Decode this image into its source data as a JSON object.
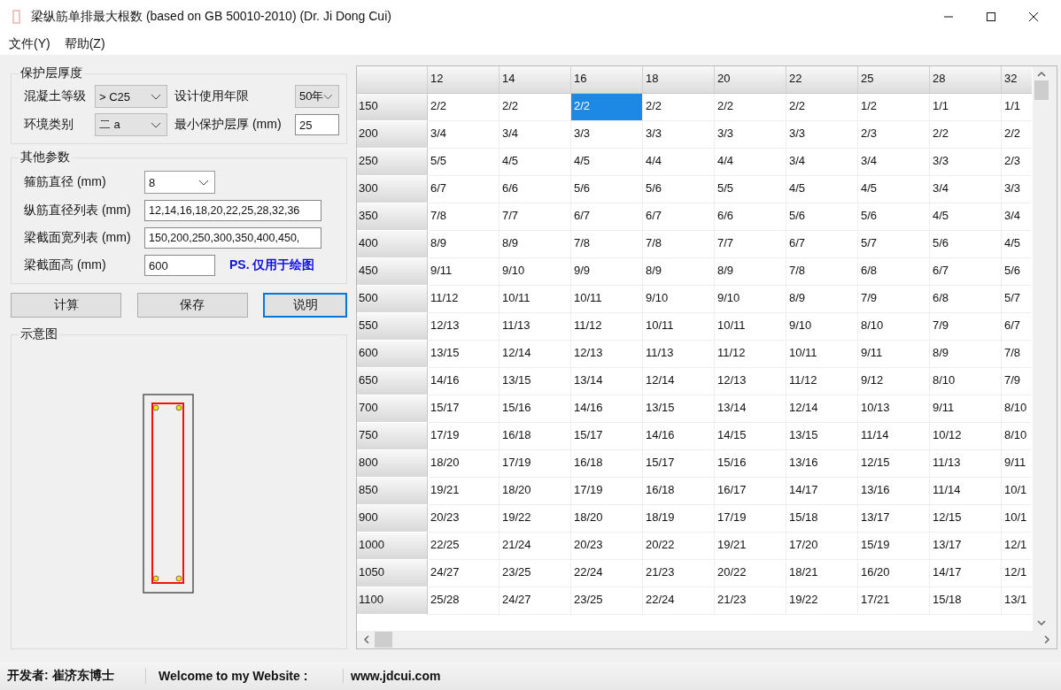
{
  "window": {
    "title": "梁纵筋单排最大根数 (based on GB 50010-2010) (Dr. Ji Dong Cui)"
  },
  "menu": [
    {
      "label": "文件(Y)"
    },
    {
      "label": "帮助(Z)"
    }
  ],
  "cover_group": {
    "title": "保护层厚度",
    "fields": [
      {
        "label": "混凝土等级",
        "kind": "select",
        "value": "> C25"
      },
      {
        "label": "设计使用年限",
        "kind": "select",
        "value": "50年"
      },
      {
        "label": "环境类别",
        "kind": "select",
        "value": "二 a"
      },
      {
        "label": "最小保护层厚 (mm)",
        "kind": "input",
        "value": "25"
      }
    ]
  },
  "other_group": {
    "title": "其他参数",
    "fields": [
      {
        "label": "箍筋直径 (mm)",
        "kind": "select",
        "value": "8"
      },
      {
        "label": "纵筋直径列表 (mm)",
        "kind": "input",
        "value": "12,14,16,18,20,22,25,28,32,36"
      },
      {
        "label": "梁截面宽列表 (mm)",
        "kind": "input",
        "value": "150,200,250,300,350,400,450,"
      },
      {
        "label": "梁截面高 (mm)",
        "kind": "short",
        "value": "600",
        "note": "PS. 仅用于绘图"
      }
    ]
  },
  "buttons": [
    {
      "label": "计算",
      "focused": false
    },
    {
      "label": "保存",
      "focused": false
    },
    {
      "label": "说明",
      "focused": true
    }
  ],
  "diagram": {
    "title": "示意图"
  },
  "table": {
    "columns": [
      "12",
      "14",
      "16",
      "18",
      "20",
      "22",
      "25",
      "28",
      "32"
    ],
    "rows": [
      {
        "header": "150",
        "cells": [
          {
            "text": "2/2",
            "selected": false
          },
          {
            "text": "2/2",
            "selected": false
          },
          {
            "text": "2/2",
            "selected": true
          },
          {
            "text": "2/2",
            "selected": false
          },
          {
            "text": "2/2",
            "selected": false
          },
          {
            "text": "2/2",
            "selected": false
          },
          {
            "text": "1/2",
            "selected": false
          },
          {
            "text": "1/1",
            "selected": false
          },
          {
            "text": "1/1",
            "selected": false
          }
        ]
      },
      {
        "header": "200",
        "cells": [
          {
            "text": "3/4",
            "selected": false
          },
          {
            "text": "3/4",
            "selected": false
          },
          {
            "text": "3/3",
            "selected": false
          },
          {
            "text": "3/3",
            "selected": false
          },
          {
            "text": "3/3",
            "selected": false
          },
          {
            "text": "3/3",
            "selected": false
          },
          {
            "text": "2/3",
            "selected": false
          },
          {
            "text": "2/2",
            "selected": false
          },
          {
            "text": "2/2",
            "selected": false
          }
        ]
      },
      {
        "header": "250",
        "cells": [
          {
            "text": "5/5",
            "selected": false
          },
          {
            "text": "4/5",
            "selected": false
          },
          {
            "text": "4/5",
            "selected": false
          },
          {
            "text": "4/4",
            "selected": false
          },
          {
            "text": "4/4",
            "selected": false
          },
          {
            "text": "3/4",
            "selected": false
          },
          {
            "text": "3/4",
            "selected": false
          },
          {
            "text": "3/3",
            "selected": false
          },
          {
            "text": "2/3",
            "selected": false
          }
        ]
      },
      {
        "header": "300",
        "cells": [
          {
            "text": "6/7",
            "selected": false
          },
          {
            "text": "6/6",
            "selected": false
          },
          {
            "text": "5/6",
            "selected": false
          },
          {
            "text": "5/6",
            "selected": false
          },
          {
            "text": "5/5",
            "selected": false
          },
          {
            "text": "4/5",
            "selected": false
          },
          {
            "text": "4/5",
            "selected": false
          },
          {
            "text": "3/4",
            "selected": false
          },
          {
            "text": "3/3",
            "selected": false
          }
        ]
      },
      {
        "header": "350",
        "cells": [
          {
            "text": "7/8",
            "selected": false
          },
          {
            "text": "7/7",
            "selected": false
          },
          {
            "text": "6/7",
            "selected": false
          },
          {
            "text": "6/7",
            "selected": false
          },
          {
            "text": "6/6",
            "selected": false
          },
          {
            "text": "5/6",
            "selected": false
          },
          {
            "text": "5/6",
            "selected": false
          },
          {
            "text": "4/5",
            "selected": false
          },
          {
            "text": "3/4",
            "selected": false
          }
        ]
      },
      {
        "header": "400",
        "cells": [
          {
            "text": "8/9",
            "selected": false
          },
          {
            "text": "8/9",
            "selected": false
          },
          {
            "text": "7/8",
            "selected": false
          },
          {
            "text": "7/8",
            "selected": false
          },
          {
            "text": "7/7",
            "selected": false
          },
          {
            "text": "6/7",
            "selected": false
          },
          {
            "text": "5/7",
            "selected": false
          },
          {
            "text": "5/6",
            "selected": false
          },
          {
            "text": "4/5",
            "selected": false
          }
        ]
      },
      {
        "header": "450",
        "cells": [
          {
            "text": "9/11",
            "selected": false
          },
          {
            "text": "9/10",
            "selected": false
          },
          {
            "text": "9/9",
            "selected": false
          },
          {
            "text": "8/9",
            "selected": false
          },
          {
            "text": "8/9",
            "selected": false
          },
          {
            "text": "7/8",
            "selected": false
          },
          {
            "text": "6/8",
            "selected": false
          },
          {
            "text": "6/7",
            "selected": false
          },
          {
            "text": "5/6",
            "selected": false
          }
        ]
      },
      {
        "header": "500",
        "cells": [
          {
            "text": "11/12",
            "selected": false
          },
          {
            "text": "10/11",
            "selected": false
          },
          {
            "text": "10/11",
            "selected": false
          },
          {
            "text": "9/10",
            "selected": false
          },
          {
            "text": "9/10",
            "selected": false
          },
          {
            "text": "8/9",
            "selected": false
          },
          {
            "text": "7/9",
            "selected": false
          },
          {
            "text": "6/8",
            "selected": false
          },
          {
            "text": "5/7",
            "selected": false
          }
        ]
      },
      {
        "header": "550",
        "cells": [
          {
            "text": "12/13",
            "selected": false
          },
          {
            "text": "11/13",
            "selected": false
          },
          {
            "text": "11/12",
            "selected": false
          },
          {
            "text": "10/11",
            "selected": false
          },
          {
            "text": "10/11",
            "selected": false
          },
          {
            "text": "9/10",
            "selected": false
          },
          {
            "text": "8/10",
            "selected": false
          },
          {
            "text": "7/9",
            "selected": false
          },
          {
            "text": "6/7",
            "selected": false
          }
        ]
      },
      {
        "header": "600",
        "cells": [
          {
            "text": "13/15",
            "selected": false
          },
          {
            "text": "12/14",
            "selected": false
          },
          {
            "text": "12/13",
            "selected": false
          },
          {
            "text": "11/13",
            "selected": false
          },
          {
            "text": "11/12",
            "selected": false
          },
          {
            "text": "10/11",
            "selected": false
          },
          {
            "text": "9/11",
            "selected": false
          },
          {
            "text": "8/9",
            "selected": false
          },
          {
            "text": "7/8",
            "selected": false
          }
        ]
      },
      {
        "header": "650",
        "cells": [
          {
            "text": "14/16",
            "selected": false
          },
          {
            "text": "13/15",
            "selected": false
          },
          {
            "text": "13/14",
            "selected": false
          },
          {
            "text": "12/14",
            "selected": false
          },
          {
            "text": "12/13",
            "selected": false
          },
          {
            "text": "11/12",
            "selected": false
          },
          {
            "text": "9/12",
            "selected": false
          },
          {
            "text": "8/10",
            "selected": false
          },
          {
            "text": "7/9",
            "selected": false
          }
        ]
      },
      {
        "header": "700",
        "cells": [
          {
            "text": "15/17",
            "selected": false
          },
          {
            "text": "15/16",
            "selected": false
          },
          {
            "text": "14/16",
            "selected": false
          },
          {
            "text": "13/15",
            "selected": false
          },
          {
            "text": "13/14",
            "selected": false
          },
          {
            "text": "12/14",
            "selected": false
          },
          {
            "text": "10/13",
            "selected": false
          },
          {
            "text": "9/11",
            "selected": false
          },
          {
            "text": "8/10",
            "selected": false
          }
        ]
      },
      {
        "header": "750",
        "cells": [
          {
            "text": "17/19",
            "selected": false
          },
          {
            "text": "16/18",
            "selected": false
          },
          {
            "text": "15/17",
            "selected": false
          },
          {
            "text": "14/16",
            "selected": false
          },
          {
            "text": "14/15",
            "selected": false
          },
          {
            "text": "13/15",
            "selected": false
          },
          {
            "text": "11/14",
            "selected": false
          },
          {
            "text": "10/12",
            "selected": false
          },
          {
            "text": "8/10",
            "selected": false
          }
        ]
      },
      {
        "header": "800",
        "cells": [
          {
            "text": "18/20",
            "selected": false
          },
          {
            "text": "17/19",
            "selected": false
          },
          {
            "text": "16/18",
            "selected": false
          },
          {
            "text": "15/17",
            "selected": false
          },
          {
            "text": "15/16",
            "selected": false
          },
          {
            "text": "13/16",
            "selected": false
          },
          {
            "text": "12/15",
            "selected": false
          },
          {
            "text": "11/13",
            "selected": false
          },
          {
            "text": "9/11",
            "selected": false
          }
        ]
      },
      {
        "header": "850",
        "cells": [
          {
            "text": "19/21",
            "selected": false
          },
          {
            "text": "18/20",
            "selected": false
          },
          {
            "text": "17/19",
            "selected": false
          },
          {
            "text": "16/18",
            "selected": false
          },
          {
            "text": "16/17",
            "selected": false
          },
          {
            "text": "14/17",
            "selected": false
          },
          {
            "text": "13/16",
            "selected": false
          },
          {
            "text": "11/14",
            "selected": false
          },
          {
            "text": "10/1",
            "selected": false
          }
        ]
      },
      {
        "header": "900",
        "cells": [
          {
            "text": "20/23",
            "selected": false
          },
          {
            "text": "19/22",
            "selected": false
          },
          {
            "text": "18/20",
            "selected": false
          },
          {
            "text": "18/19",
            "selected": false
          },
          {
            "text": "17/19",
            "selected": false
          },
          {
            "text": "15/18",
            "selected": false
          },
          {
            "text": "13/17",
            "selected": false
          },
          {
            "text": "12/15",
            "selected": false
          },
          {
            "text": "10/1",
            "selected": false
          }
        ]
      },
      {
        "header": "1000",
        "cells": [
          {
            "text": "22/25",
            "selected": false
          },
          {
            "text": "21/24",
            "selected": false
          },
          {
            "text": "20/23",
            "selected": false
          },
          {
            "text": "20/22",
            "selected": false
          },
          {
            "text": "19/21",
            "selected": false
          },
          {
            "text": "17/20",
            "selected": false
          },
          {
            "text": "15/19",
            "selected": false
          },
          {
            "text": "13/17",
            "selected": false
          },
          {
            "text": "12/1",
            "selected": false
          }
        ]
      },
      {
        "header": "1050",
        "cells": [
          {
            "text": "24/27",
            "selected": false
          },
          {
            "text": "23/25",
            "selected": false
          },
          {
            "text": "22/24",
            "selected": false
          },
          {
            "text": "21/23",
            "selected": false
          },
          {
            "text": "20/22",
            "selected": false
          },
          {
            "text": "18/21",
            "selected": false
          },
          {
            "text": "16/20",
            "selected": false
          },
          {
            "text": "14/17",
            "selected": false
          },
          {
            "text": "12/1",
            "selected": false
          }
        ]
      },
      {
        "header": "1100",
        "cells": [
          {
            "text": "25/28",
            "selected": false
          },
          {
            "text": "24/27",
            "selected": false
          },
          {
            "text": "23/25",
            "selected": false
          },
          {
            "text": "22/24",
            "selected": false
          },
          {
            "text": "21/23",
            "selected": false
          },
          {
            "text": "19/22",
            "selected": false
          },
          {
            "text": "17/21",
            "selected": false
          },
          {
            "text": "15/18",
            "selected": false
          },
          {
            "text": "13/1",
            "selected": false
          }
        ]
      }
    ]
  },
  "status_bar": [
    "开发者: 崔济东博士",
    "Welcome to my Website :",
    "www.jdcui.com"
  ]
}
